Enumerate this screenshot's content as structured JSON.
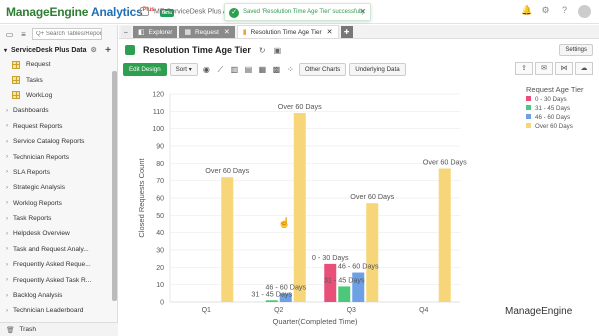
{
  "topbar": {
    "logo_brand": "ManageEngine",
    "logo_product": "Analytics",
    "logo_plus": "Plus",
    "logo_badge": "Beta",
    "breadcrumb": "ME ServiceDesk Plus Ana",
    "toast_message": "Saved 'Resolution Time Age Tier' successfully",
    "icons": [
      "bell-icon",
      "gear-icon",
      "help-icon",
      "avatar"
    ]
  },
  "sidebar": {
    "search_placeholder": "Q+ Search Tables/Reports",
    "database": "ServiceDesk Plus Data",
    "tables": [
      "Request",
      "Tasks",
      "WorkLog"
    ],
    "folders": [
      "Dashboards",
      "Request Reports",
      "Service Catalog Reports",
      "Technician Reports",
      "SLA Reports",
      "Strategic Analysis",
      "Worklog Reports",
      "Task Reports",
      "Helpdesk Overview",
      "Task and Request Analy...",
      "Frequently Asked Reque...",
      "Frequently Asked Task R...",
      "Backlog Analysis",
      "Technician Leaderboard"
    ],
    "trash": "Trash"
  },
  "tabs": [
    {
      "label": "Explorer",
      "active": false,
      "icon": "explorer-icon"
    },
    {
      "label": "Request",
      "active": false,
      "icon": "table-icon"
    },
    {
      "label": "Resolution Time Age Tier",
      "active": true,
      "icon": "chart-icon"
    }
  ],
  "report": {
    "title": "Resolution Time Age Tier",
    "settings_label": "Settings"
  },
  "toolbar": {
    "edit_design": "Edit Design",
    "sort": "Sort",
    "other_charts": "Other Charts",
    "underlying_data": "Underlying Data"
  },
  "footer_brand": "ManageEngine",
  "chart_data": {
    "type": "bar",
    "xlabel": "Quarter(Completed Time)",
    "ylabel": "Closed Requests Count",
    "ylim": [
      0,
      120
    ],
    "yticks": [
      0,
      10,
      20,
      30,
      40,
      50,
      60,
      70,
      80,
      90,
      100,
      110,
      120
    ],
    "categories": [
      "Q1",
      "Q2",
      "Q3",
      "Q4"
    ],
    "legend_title": "Request Age Tier",
    "legend_position": "right",
    "grid": true,
    "series": [
      {
        "name": "0 - 30 Days",
        "color": "#e8507a",
        "values": [
          0,
          0,
          22,
          0
        ]
      },
      {
        "name": "31 - 45 Days",
        "color": "#4cc87a",
        "values": [
          0,
          1,
          9,
          0
        ]
      },
      {
        "name": "46 - 60 Days",
        "color": "#6ea0e6",
        "values": [
          0,
          5,
          17,
          0
        ]
      },
      {
        "name": "Over 60 Days",
        "color": "#f7d67a",
        "values": [
          72,
          109,
          57,
          77
        ]
      }
    ],
    "data_labels": [
      {
        "category": "Q1",
        "series": "Over 60 Days",
        "text": "Over 60 Days"
      },
      {
        "category": "Q2",
        "series": "46 - 60 Days",
        "text": "46 - 60 Days"
      },
      {
        "category": "Q2",
        "series": "31 - 45 Days",
        "text": "31 - 45 Days"
      },
      {
        "category": "Q2",
        "series": "Over 60 Days",
        "text": "Over 60 Days"
      },
      {
        "category": "Q3",
        "series": "0 - 30 Days",
        "text": "0 - 30 Days"
      },
      {
        "category": "Q3",
        "series": "31 - 45 Days",
        "text": "31 - 45 Days"
      },
      {
        "category": "Q3",
        "series": "46 - 60 Days",
        "text": "46 - 60 Days"
      },
      {
        "category": "Q3",
        "series": "Over 60 Days",
        "text": "Over 60 Days"
      },
      {
        "category": "Q4",
        "series": "Over 60 Days",
        "text": "Over 60 Days"
      }
    ]
  }
}
